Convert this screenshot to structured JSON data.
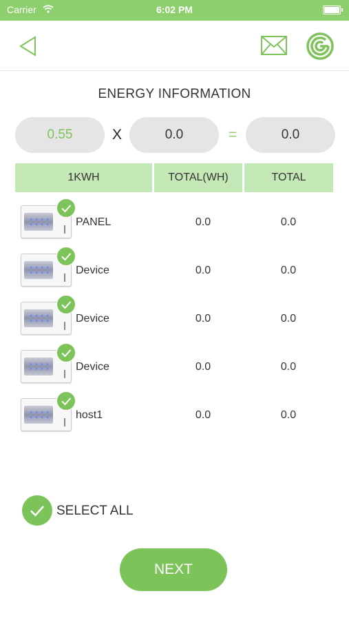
{
  "status_bar": {
    "carrier": "Carrier",
    "time": "6:02 PM"
  },
  "header": {
    "title": "ENERGY INFORMATION"
  },
  "calculator": {
    "rate": "0.55",
    "multiply_symbol": "X",
    "total": "0.0",
    "equals_symbol": "=",
    "result": "0.0"
  },
  "table": {
    "headers": [
      "1KWH",
      "TOTAL(WH)",
      "TOTAL"
    ],
    "rows": [
      {
        "name": "PANEL",
        "total_wh": "0.0",
        "total": "0.0",
        "checked": true
      },
      {
        "name": "Device",
        "total_wh": "0.0",
        "total": "0.0",
        "checked": true
      },
      {
        "name": "Device",
        "total_wh": "0.0",
        "total": "0.0",
        "checked": true
      },
      {
        "name": "Device",
        "total_wh": "0.0",
        "total": "0.0",
        "checked": true
      },
      {
        "name": "host1",
        "total_wh": "0.0",
        "total": "0.0",
        "checked": true
      }
    ]
  },
  "select_all": {
    "label": "SELECT ALL",
    "checked": true
  },
  "next_button": {
    "label": "NEXT"
  },
  "icons": {
    "back": "back-triangle-icon",
    "mail": "mail-icon",
    "logo": "brand-logo-icon"
  },
  "colors": {
    "accent": "#7cc35a",
    "status_bar": "#8ecf6d",
    "header_row": "#c4e8b6",
    "pill": "#e5e5e5"
  }
}
